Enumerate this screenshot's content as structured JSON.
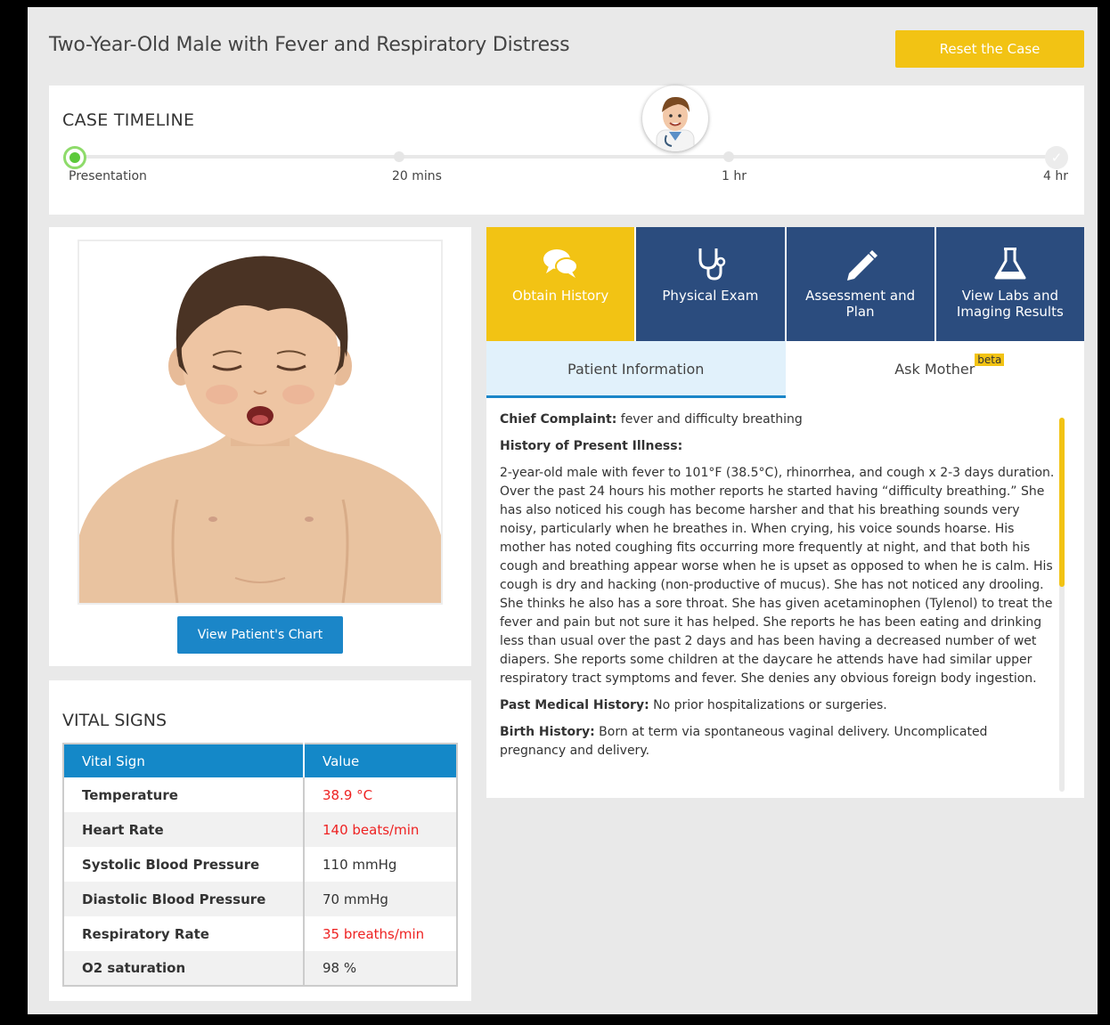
{
  "header": {
    "title": "Two-Year-Old Male with Fever and Respiratory Distress",
    "reset_label": "Reset the Case"
  },
  "timeline": {
    "title": "CASE TIMELINE",
    "points": [
      "Presentation",
      "20 mins",
      "1 hr",
      "4 hr"
    ]
  },
  "patient": {
    "chart_button": "View Patient's Chart"
  },
  "vitals": {
    "title": "VITAL SIGNS",
    "col_sign": "Vital Sign",
    "col_value": "Value",
    "rows": [
      {
        "sign": "Temperature",
        "value": "38.9 °C",
        "abnormal": true
      },
      {
        "sign": "Heart Rate",
        "value": "140 beats/min",
        "abnormal": true
      },
      {
        "sign": "Systolic Blood Pressure",
        "value": "110 mmHg",
        "abnormal": false
      },
      {
        "sign": "Diastolic Blood Pressure",
        "value": "70 mmHg",
        "abnormal": false
      },
      {
        "sign": "Respiratory Rate",
        "value": "35 breaths/min",
        "abnormal": true
      },
      {
        "sign": "O2 saturation",
        "value": "98 %",
        "abnormal": false
      }
    ]
  },
  "tabs": [
    {
      "label": "Obtain History",
      "icon": "chat-bubbles-icon"
    },
    {
      "label": "Physical Exam",
      "icon": "stethoscope-icon"
    },
    {
      "label": "Assessment and Plan",
      "icon": "pencil-icon"
    },
    {
      "label": "View Labs and Imaging Results",
      "icon": "flask-icon"
    }
  ],
  "subtabs": {
    "patient_info": "Patient Information",
    "ask_mother": "Ask Mother",
    "beta": "beta"
  },
  "info": {
    "chief_label": "Chief Complaint:",
    "chief_text": "fever and difficulty breathing",
    "hpi_label": "History of Present Illness:",
    "hpi_text": "2-year-old male with fever to 101°F (38.5°C), rhinorrhea, and cough x 2-3 days duration. Over the past 24 hours his mother reports he started having “difficulty breathing.” She has also noticed his cough has become harsher and that his breathing sounds very noisy, particularly when he breathes in. When crying, his voice sounds hoarse. His mother has noted coughing fits occurring more frequently at night, and that both his cough and breathing appear worse when he is upset as opposed to when he is calm. His cough is dry and hacking (non-productive of mucus). She has not noticed any drooling. She thinks he also has a sore throat. She has given acetaminophen (Tylenol) to treat the fever and pain but not sure it has helped. She reports he has been eating and drinking less than usual over the past 2 days and has been having a decreased number of wet diapers. She reports some children at the daycare he attends have had similar upper respiratory tract symptoms and fever. She denies any obvious foreign body ingestion.",
    "pmh_label": "Past Medical History:",
    "pmh_text": "No prior hospitalizations or surgeries.",
    "birth_label": "Birth History:",
    "birth_text": "Born at term via spontaneous vaginal delivery. Uncomplicated pregnancy and delivery."
  },
  "colors": {
    "accent_yellow": "#f2c314",
    "tab_blue": "#2b4c7e",
    "button_blue": "#1b86c8",
    "abnormal_red": "#ee2222"
  }
}
